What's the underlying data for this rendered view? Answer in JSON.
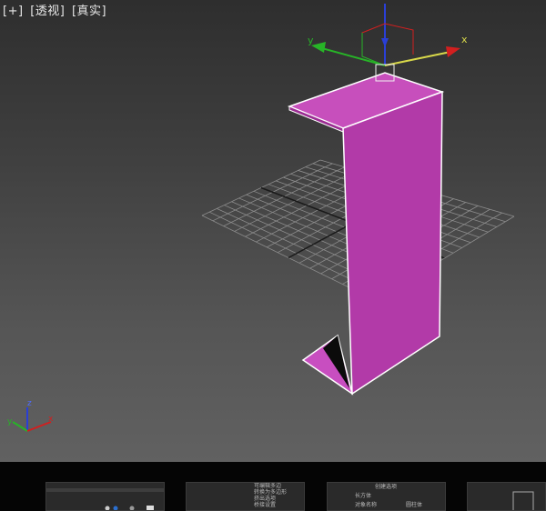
{
  "viewport": {
    "label_parts": [
      "[+]",
      "[透视]",
      "[真实]"
    ]
  },
  "gizmo": {
    "x_label": "x",
    "y_label": "y"
  },
  "axis_tripod": {
    "x_label": "x",
    "y_label": "y",
    "z_label": "z"
  },
  "colors": {
    "object": "#b23aa8",
    "object_top": "#c74fbc",
    "grid": "#8a8a8a",
    "axis_x": "#d21f1f",
    "axis_y": "#27b427",
    "axis_z": "#2a3fd6"
  },
  "thumbnails": [
    {
      "texts": []
    },
    {
      "texts": [
        "可编辑多边",
        "转换为多边形",
        "挤出选项",
        "桥接设置"
      ]
    },
    {
      "texts": [
        "创建选项",
        "长方体",
        "对象名称",
        "圆柱体"
      ]
    },
    {
      "texts": []
    }
  ]
}
